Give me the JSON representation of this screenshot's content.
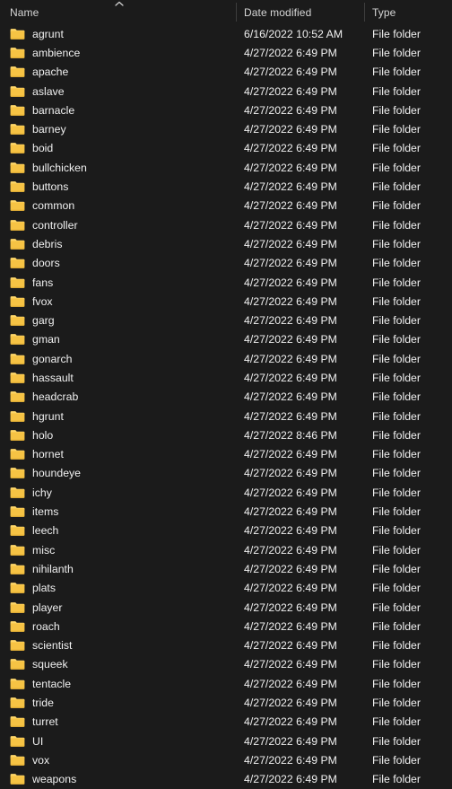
{
  "theme": {
    "background": "#1b1b1b",
    "text": "#f0f0f0",
    "header_text": "#d6d6d6",
    "divider": "#3d3d3d",
    "folder_body": "#f6c344",
    "folder_tab": "#ffd86b",
    "folder_shadow": "#e0a92f"
  },
  "columns": {
    "name": {
      "label": "Name",
      "sort_icon": "chevron-up-icon",
      "sort_direction": "ascending"
    },
    "date_modified": {
      "label": "Date modified"
    },
    "type": {
      "label": "Type"
    }
  },
  "rows": [
    {
      "icon": "folder-icon",
      "name": "agrunt",
      "date_modified": "6/16/2022 10:52 AM",
      "type": "File folder"
    },
    {
      "icon": "folder-icon",
      "name": "ambience",
      "date_modified": "4/27/2022 6:49 PM",
      "type": "File folder"
    },
    {
      "icon": "folder-icon",
      "name": "apache",
      "date_modified": "4/27/2022 6:49 PM",
      "type": "File folder"
    },
    {
      "icon": "folder-icon",
      "name": "aslave",
      "date_modified": "4/27/2022 6:49 PM",
      "type": "File folder"
    },
    {
      "icon": "folder-icon",
      "name": "barnacle",
      "date_modified": "4/27/2022 6:49 PM",
      "type": "File folder"
    },
    {
      "icon": "folder-icon",
      "name": "barney",
      "date_modified": "4/27/2022 6:49 PM",
      "type": "File folder"
    },
    {
      "icon": "folder-icon",
      "name": "boid",
      "date_modified": "4/27/2022 6:49 PM",
      "type": "File folder"
    },
    {
      "icon": "folder-icon",
      "name": "bullchicken",
      "date_modified": "4/27/2022 6:49 PM",
      "type": "File folder"
    },
    {
      "icon": "folder-icon",
      "name": "buttons",
      "date_modified": "4/27/2022 6:49 PM",
      "type": "File folder"
    },
    {
      "icon": "folder-icon",
      "name": "common",
      "date_modified": "4/27/2022 6:49 PM",
      "type": "File folder"
    },
    {
      "icon": "folder-icon",
      "name": "controller",
      "date_modified": "4/27/2022 6:49 PM",
      "type": "File folder"
    },
    {
      "icon": "folder-icon",
      "name": "debris",
      "date_modified": "4/27/2022 6:49 PM",
      "type": "File folder"
    },
    {
      "icon": "folder-icon",
      "name": "doors",
      "date_modified": "4/27/2022 6:49 PM",
      "type": "File folder"
    },
    {
      "icon": "folder-icon",
      "name": "fans",
      "date_modified": "4/27/2022 6:49 PM",
      "type": "File folder"
    },
    {
      "icon": "folder-icon",
      "name": "fvox",
      "date_modified": "4/27/2022 6:49 PM",
      "type": "File folder"
    },
    {
      "icon": "folder-icon",
      "name": "garg",
      "date_modified": "4/27/2022 6:49 PM",
      "type": "File folder"
    },
    {
      "icon": "folder-icon",
      "name": "gman",
      "date_modified": "4/27/2022 6:49 PM",
      "type": "File folder"
    },
    {
      "icon": "folder-icon",
      "name": "gonarch",
      "date_modified": "4/27/2022 6:49 PM",
      "type": "File folder"
    },
    {
      "icon": "folder-icon",
      "name": "hassault",
      "date_modified": "4/27/2022 6:49 PM",
      "type": "File folder"
    },
    {
      "icon": "folder-icon",
      "name": "headcrab",
      "date_modified": "4/27/2022 6:49 PM",
      "type": "File folder"
    },
    {
      "icon": "folder-icon",
      "name": "hgrunt",
      "date_modified": "4/27/2022 6:49 PM",
      "type": "File folder"
    },
    {
      "icon": "folder-icon",
      "name": "holo",
      "date_modified": "4/27/2022 8:46 PM",
      "type": "File folder"
    },
    {
      "icon": "folder-icon",
      "name": "hornet",
      "date_modified": "4/27/2022 6:49 PM",
      "type": "File folder"
    },
    {
      "icon": "folder-icon",
      "name": "houndeye",
      "date_modified": "4/27/2022 6:49 PM",
      "type": "File folder"
    },
    {
      "icon": "folder-icon",
      "name": "ichy",
      "date_modified": "4/27/2022 6:49 PM",
      "type": "File folder"
    },
    {
      "icon": "folder-icon",
      "name": "items",
      "date_modified": "4/27/2022 6:49 PM",
      "type": "File folder"
    },
    {
      "icon": "folder-icon",
      "name": "leech",
      "date_modified": "4/27/2022 6:49 PM",
      "type": "File folder"
    },
    {
      "icon": "folder-icon",
      "name": "misc",
      "date_modified": "4/27/2022 6:49 PM",
      "type": "File folder"
    },
    {
      "icon": "folder-icon",
      "name": "nihilanth",
      "date_modified": "4/27/2022 6:49 PM",
      "type": "File folder"
    },
    {
      "icon": "folder-icon",
      "name": "plats",
      "date_modified": "4/27/2022 6:49 PM",
      "type": "File folder"
    },
    {
      "icon": "folder-icon",
      "name": "player",
      "date_modified": "4/27/2022 6:49 PM",
      "type": "File folder"
    },
    {
      "icon": "folder-icon",
      "name": "roach",
      "date_modified": "4/27/2022 6:49 PM",
      "type": "File folder"
    },
    {
      "icon": "folder-icon",
      "name": "scientist",
      "date_modified": "4/27/2022 6:49 PM",
      "type": "File folder"
    },
    {
      "icon": "folder-icon",
      "name": "squeek",
      "date_modified": "4/27/2022 6:49 PM",
      "type": "File folder"
    },
    {
      "icon": "folder-icon",
      "name": "tentacle",
      "date_modified": "4/27/2022 6:49 PM",
      "type": "File folder"
    },
    {
      "icon": "folder-icon",
      "name": "tride",
      "date_modified": "4/27/2022 6:49 PM",
      "type": "File folder"
    },
    {
      "icon": "folder-icon",
      "name": "turret",
      "date_modified": "4/27/2022 6:49 PM",
      "type": "File folder"
    },
    {
      "icon": "folder-icon",
      "name": "UI",
      "date_modified": "4/27/2022 6:49 PM",
      "type": "File folder"
    },
    {
      "icon": "folder-icon",
      "name": "vox",
      "date_modified": "4/27/2022 6:49 PM",
      "type": "File folder"
    },
    {
      "icon": "folder-icon",
      "name": "weapons",
      "date_modified": "4/27/2022 6:49 PM",
      "type": "File folder"
    }
  ]
}
